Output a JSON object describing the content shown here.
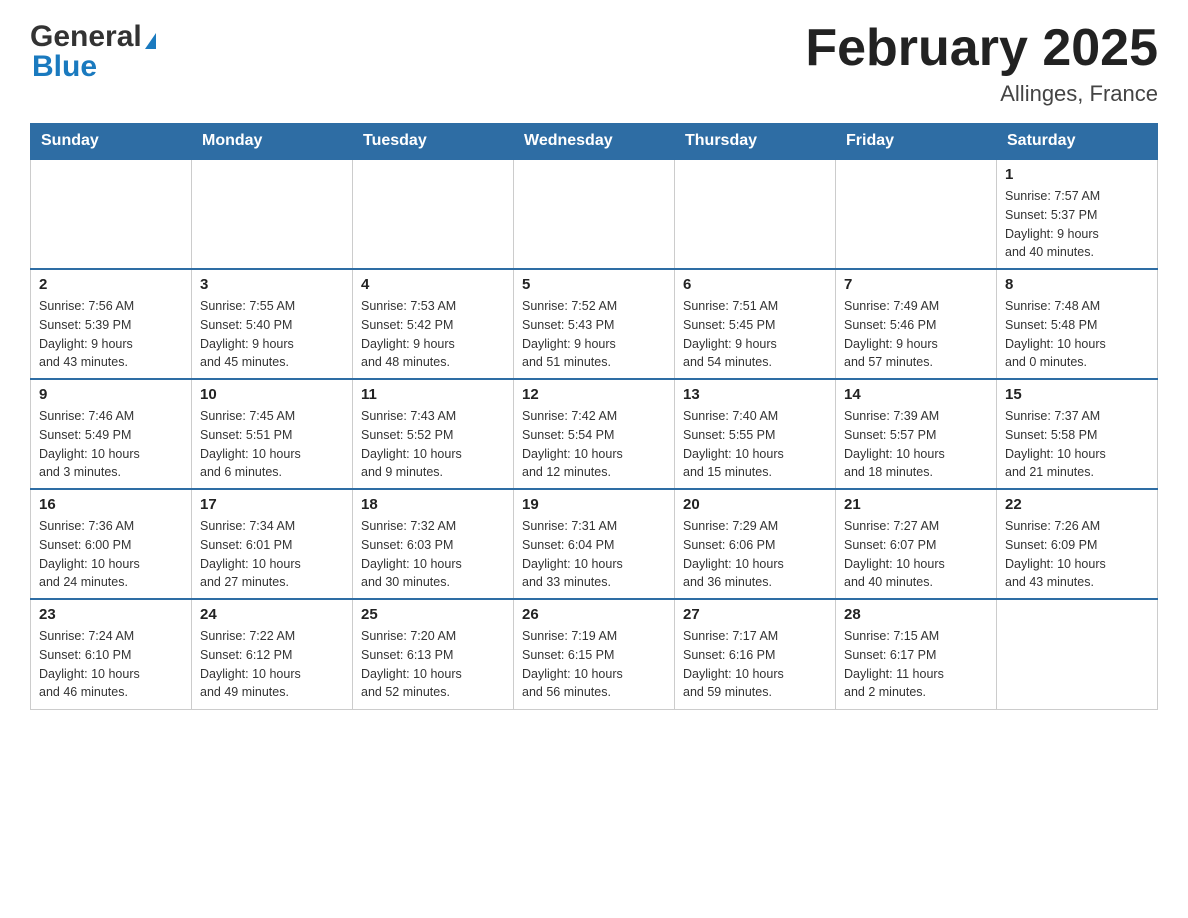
{
  "logo": {
    "text1": "General",
    "text2": "Blue"
  },
  "title": "February 2025",
  "location": "Allinges, France",
  "days_of_week": [
    "Sunday",
    "Monday",
    "Tuesday",
    "Wednesday",
    "Thursday",
    "Friday",
    "Saturday"
  ],
  "weeks": [
    {
      "days": [
        {
          "number": "",
          "info": ""
        },
        {
          "number": "",
          "info": ""
        },
        {
          "number": "",
          "info": ""
        },
        {
          "number": "",
          "info": ""
        },
        {
          "number": "",
          "info": ""
        },
        {
          "number": "",
          "info": ""
        },
        {
          "number": "1",
          "info": "Sunrise: 7:57 AM\nSunset: 5:37 PM\nDaylight: 9 hours\nand 40 minutes."
        }
      ]
    },
    {
      "days": [
        {
          "number": "2",
          "info": "Sunrise: 7:56 AM\nSunset: 5:39 PM\nDaylight: 9 hours\nand 43 minutes."
        },
        {
          "number": "3",
          "info": "Sunrise: 7:55 AM\nSunset: 5:40 PM\nDaylight: 9 hours\nand 45 minutes."
        },
        {
          "number": "4",
          "info": "Sunrise: 7:53 AM\nSunset: 5:42 PM\nDaylight: 9 hours\nand 48 minutes."
        },
        {
          "number": "5",
          "info": "Sunrise: 7:52 AM\nSunset: 5:43 PM\nDaylight: 9 hours\nand 51 minutes."
        },
        {
          "number": "6",
          "info": "Sunrise: 7:51 AM\nSunset: 5:45 PM\nDaylight: 9 hours\nand 54 minutes."
        },
        {
          "number": "7",
          "info": "Sunrise: 7:49 AM\nSunset: 5:46 PM\nDaylight: 9 hours\nand 57 minutes."
        },
        {
          "number": "8",
          "info": "Sunrise: 7:48 AM\nSunset: 5:48 PM\nDaylight: 10 hours\nand 0 minutes."
        }
      ]
    },
    {
      "days": [
        {
          "number": "9",
          "info": "Sunrise: 7:46 AM\nSunset: 5:49 PM\nDaylight: 10 hours\nand 3 minutes."
        },
        {
          "number": "10",
          "info": "Sunrise: 7:45 AM\nSunset: 5:51 PM\nDaylight: 10 hours\nand 6 minutes."
        },
        {
          "number": "11",
          "info": "Sunrise: 7:43 AM\nSunset: 5:52 PM\nDaylight: 10 hours\nand 9 minutes."
        },
        {
          "number": "12",
          "info": "Sunrise: 7:42 AM\nSunset: 5:54 PM\nDaylight: 10 hours\nand 12 minutes."
        },
        {
          "number": "13",
          "info": "Sunrise: 7:40 AM\nSunset: 5:55 PM\nDaylight: 10 hours\nand 15 minutes."
        },
        {
          "number": "14",
          "info": "Sunrise: 7:39 AM\nSunset: 5:57 PM\nDaylight: 10 hours\nand 18 minutes."
        },
        {
          "number": "15",
          "info": "Sunrise: 7:37 AM\nSunset: 5:58 PM\nDaylight: 10 hours\nand 21 minutes."
        }
      ]
    },
    {
      "days": [
        {
          "number": "16",
          "info": "Sunrise: 7:36 AM\nSunset: 6:00 PM\nDaylight: 10 hours\nand 24 minutes."
        },
        {
          "number": "17",
          "info": "Sunrise: 7:34 AM\nSunset: 6:01 PM\nDaylight: 10 hours\nand 27 minutes."
        },
        {
          "number": "18",
          "info": "Sunrise: 7:32 AM\nSunset: 6:03 PM\nDaylight: 10 hours\nand 30 minutes."
        },
        {
          "number": "19",
          "info": "Sunrise: 7:31 AM\nSunset: 6:04 PM\nDaylight: 10 hours\nand 33 minutes."
        },
        {
          "number": "20",
          "info": "Sunrise: 7:29 AM\nSunset: 6:06 PM\nDaylight: 10 hours\nand 36 minutes."
        },
        {
          "number": "21",
          "info": "Sunrise: 7:27 AM\nSunset: 6:07 PM\nDaylight: 10 hours\nand 40 minutes."
        },
        {
          "number": "22",
          "info": "Sunrise: 7:26 AM\nSunset: 6:09 PM\nDaylight: 10 hours\nand 43 minutes."
        }
      ]
    },
    {
      "days": [
        {
          "number": "23",
          "info": "Sunrise: 7:24 AM\nSunset: 6:10 PM\nDaylight: 10 hours\nand 46 minutes."
        },
        {
          "number": "24",
          "info": "Sunrise: 7:22 AM\nSunset: 6:12 PM\nDaylight: 10 hours\nand 49 minutes."
        },
        {
          "number": "25",
          "info": "Sunrise: 7:20 AM\nSunset: 6:13 PM\nDaylight: 10 hours\nand 52 minutes."
        },
        {
          "number": "26",
          "info": "Sunrise: 7:19 AM\nSunset: 6:15 PM\nDaylight: 10 hours\nand 56 minutes."
        },
        {
          "number": "27",
          "info": "Sunrise: 7:17 AM\nSunset: 6:16 PM\nDaylight: 10 hours\nand 59 minutes."
        },
        {
          "number": "28",
          "info": "Sunrise: 7:15 AM\nSunset: 6:17 PM\nDaylight: 11 hours\nand 2 minutes."
        },
        {
          "number": "",
          "info": ""
        }
      ]
    }
  ]
}
